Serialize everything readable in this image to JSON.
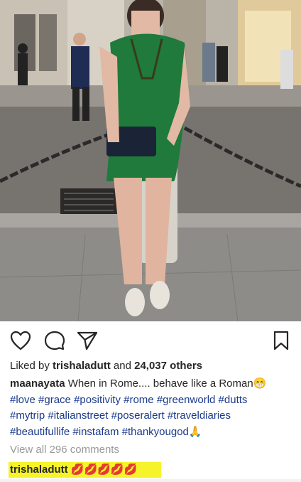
{
  "post": {
    "liked_by_prefix": "Liked by ",
    "liked_by_user": "trishaladutt",
    "liked_by_and": " and ",
    "liked_by_count": "24,037 others",
    "caption_user": "maanayata",
    "caption_text": " When in Rome.... behave like a Roman",
    "caption_emoji": "😁",
    "hashtags_line1": [
      "#love",
      "#grace",
      "#positivity",
      "#rome",
      "#greenworld",
      "#dutts"
    ],
    "hashtags_line2": [
      "#mytrip",
      "#italianstreet",
      "#poseralert",
      "#traveldiaries"
    ],
    "hashtags_line3": [
      "#beautifullife",
      "#instafam",
      "#thankyougod"
    ],
    "hashtags_line3_emoji": "🙏",
    "view_all_comments": "View all 296 comments",
    "comment_user": "trishaladutt",
    "comment_text": "💋💋💋💋💋"
  },
  "icons": {
    "like": "heart-outline-icon",
    "comment": "speech-bubble-icon",
    "share": "paper-plane-icon",
    "save": "bookmark-icon"
  },
  "colors": {
    "hashtag": "#1b3a8a",
    "highlight": "#f7f32a",
    "muted": "#999999"
  }
}
